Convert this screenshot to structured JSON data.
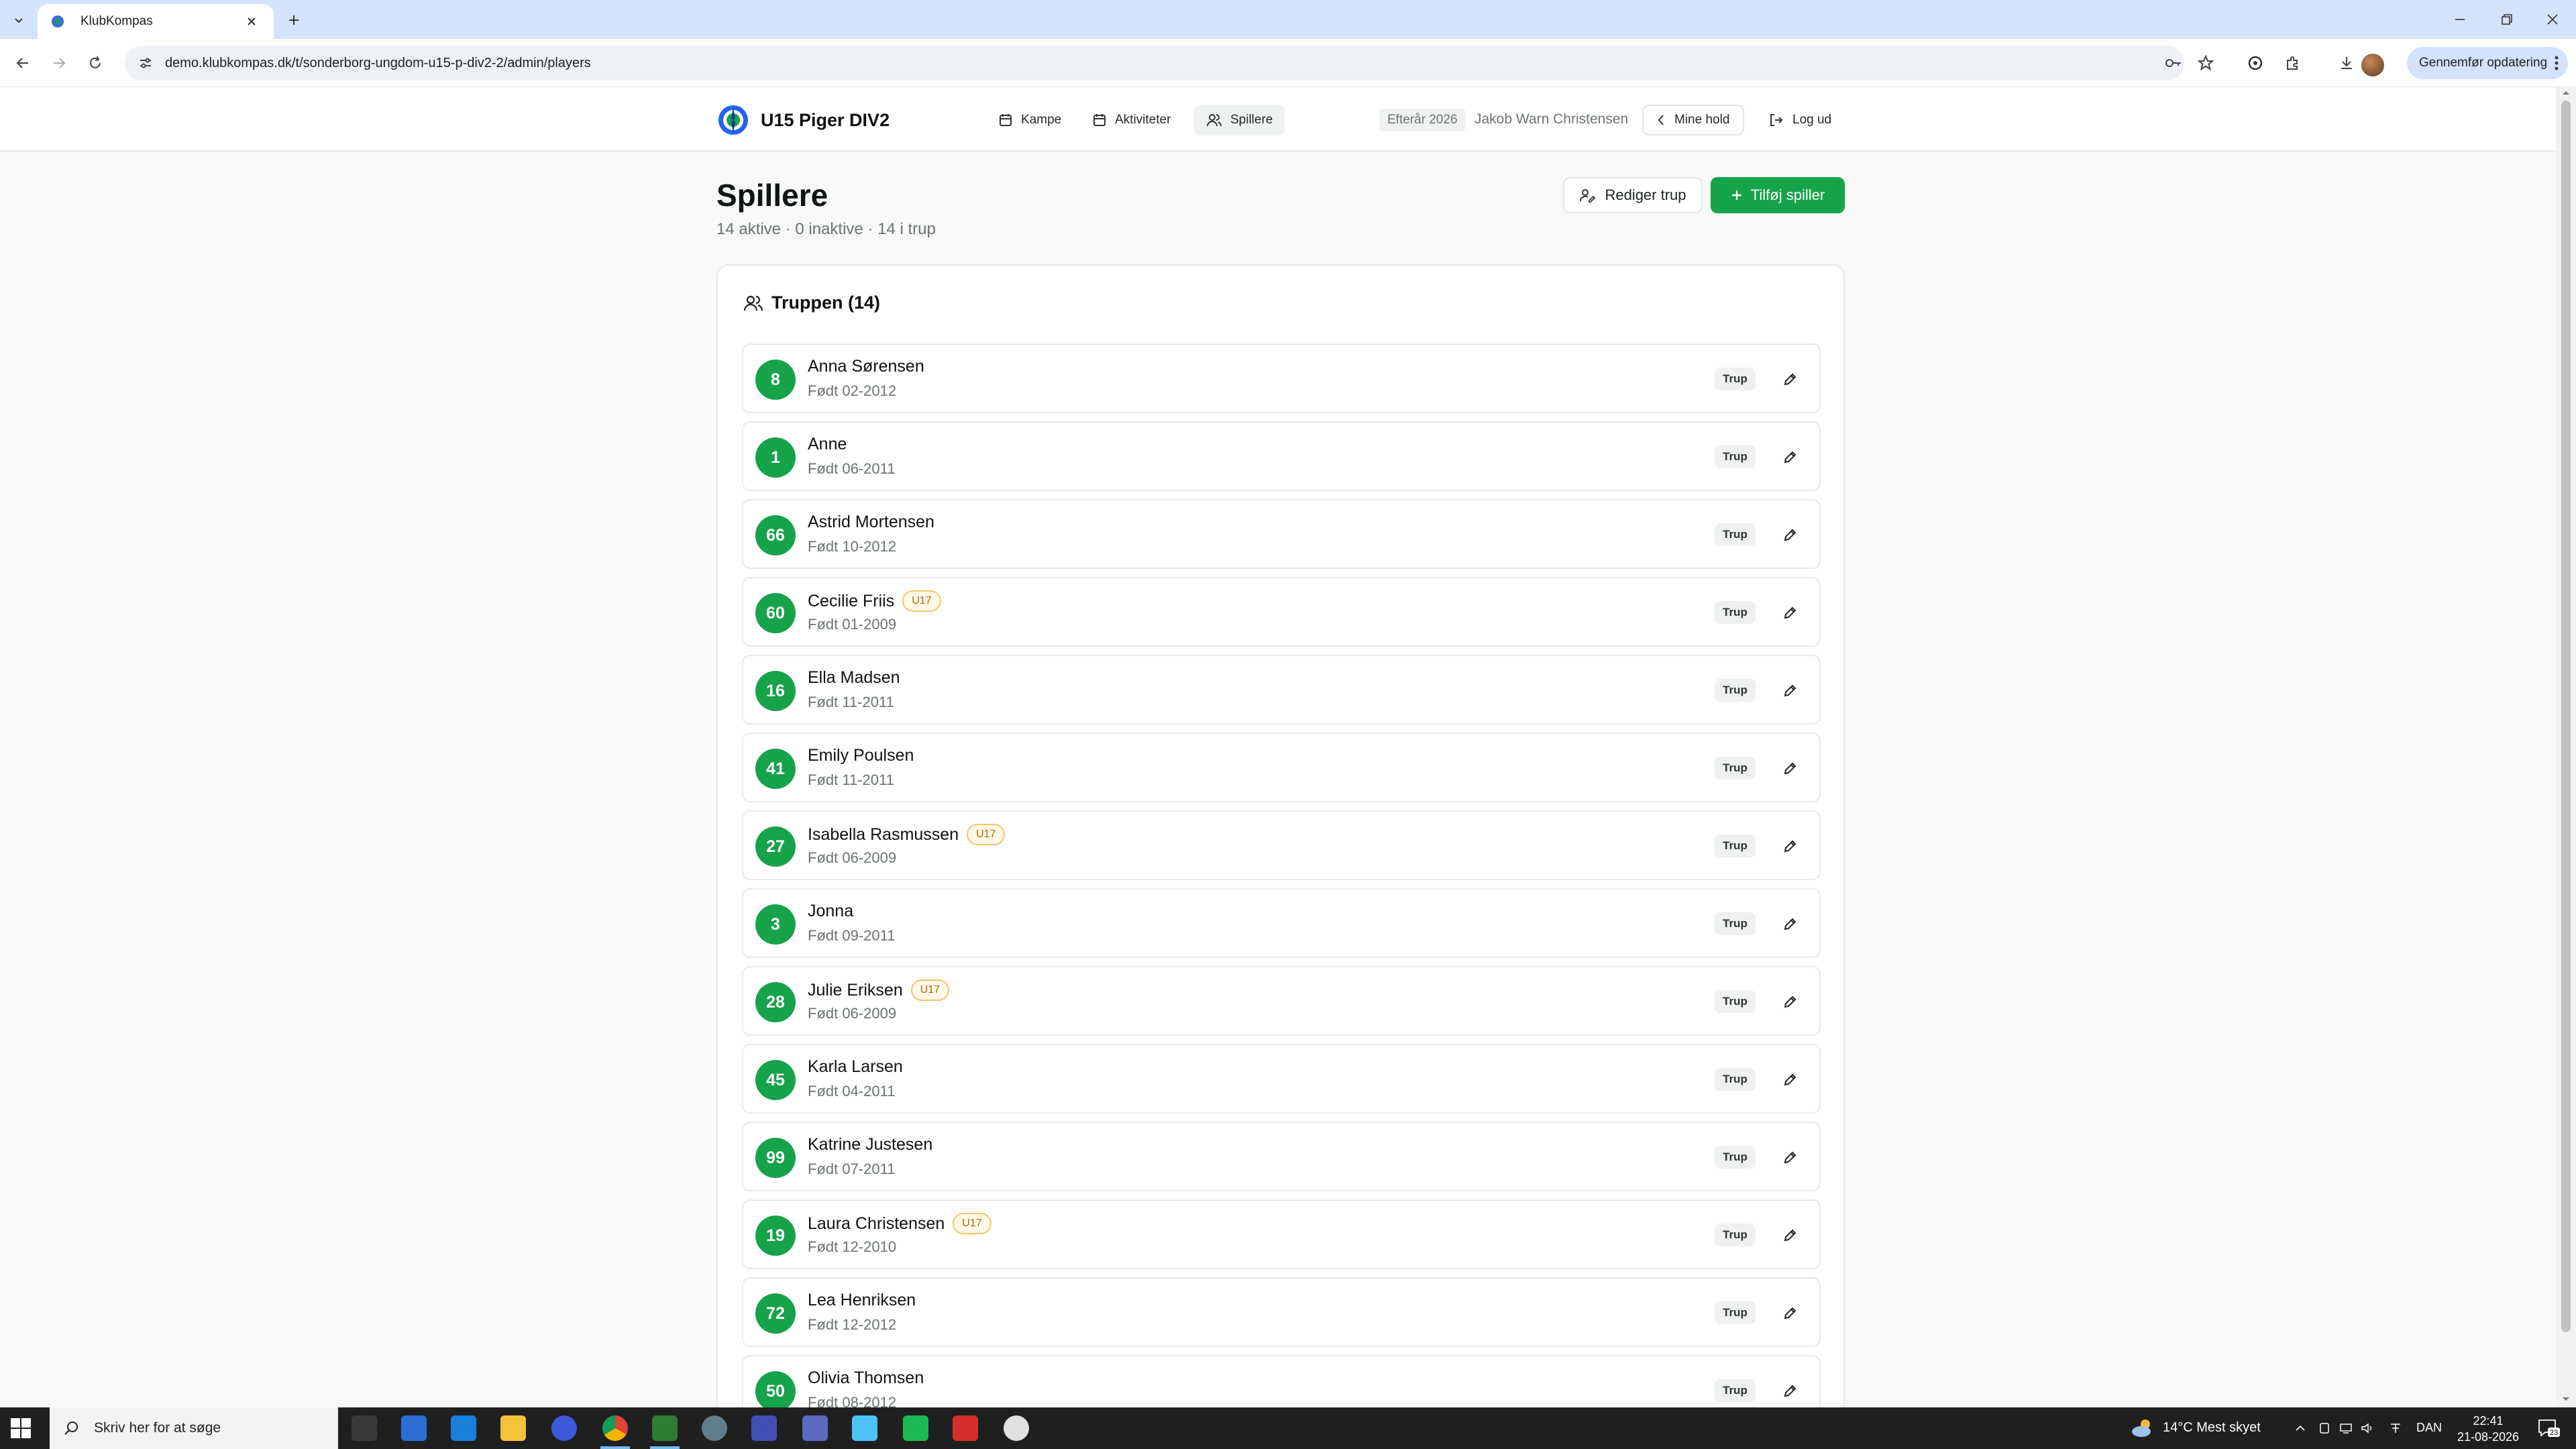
{
  "browser": {
    "tab_title": "KlubKompas",
    "url": "demo.klubkompas.dk/t/sonderborg-ungdom-u15-p-div2-2/admin/players",
    "update_label": "Gennemfør opdatering"
  },
  "header": {
    "team_name": "U15 Piger DIV2",
    "nav": [
      {
        "label": "Kampe",
        "icon": "calendar-icon"
      },
      {
        "label": "Aktiviteter",
        "icon": "calendar-icon"
      },
      {
        "label": "Spillere",
        "icon": "users-icon",
        "active": true
      }
    ],
    "season": "Efterår 2026",
    "user": "Jakob Warn Christensen",
    "mine_hold": "Mine hold",
    "logout": "Log ud"
  },
  "page": {
    "title": "Spillere",
    "subtitle": "14 aktive · 0 inaktive · 14 i trup",
    "edit_squad": "Rediger trup",
    "add_player": "Tilføj spiller"
  },
  "squad": {
    "heading": "Truppen (14)",
    "players": [
      {
        "number": "8",
        "name": "Anna Sørensen",
        "born": "Født 02-2012",
        "badge": "",
        "status": "Trup"
      },
      {
        "number": "1",
        "name": "Anne",
        "born": "Født 06-2011",
        "badge": "",
        "status": "Trup"
      },
      {
        "number": "66",
        "name": "Astrid Mortensen",
        "born": "Født 10-2012",
        "badge": "",
        "status": "Trup"
      },
      {
        "number": "60",
        "name": "Cecilie Friis",
        "born": "Født 01-2009",
        "badge": "U17",
        "status": "Trup"
      },
      {
        "number": "16",
        "name": "Ella Madsen",
        "born": "Født 11-2011",
        "badge": "",
        "status": "Trup"
      },
      {
        "number": "41",
        "name": "Emily Poulsen",
        "born": "Født 11-2011",
        "badge": "",
        "status": "Trup"
      },
      {
        "number": "27",
        "name": "Isabella Rasmussen",
        "born": "Født 06-2009",
        "badge": "U17",
        "status": "Trup"
      },
      {
        "number": "3",
        "name": "Jonna",
        "born": "Født 09-2011",
        "badge": "",
        "status": "Trup"
      },
      {
        "number": "28",
        "name": "Julie Eriksen",
        "born": "Født 06-2009",
        "badge": "U17",
        "status": "Trup"
      },
      {
        "number": "45",
        "name": "Karla Larsen",
        "born": "Født 04-2011",
        "badge": "",
        "status": "Trup"
      },
      {
        "number": "99",
        "name": "Katrine Justesen",
        "born": "Født 07-2011",
        "badge": "",
        "status": "Trup"
      },
      {
        "number": "19",
        "name": "Laura Christensen",
        "born": "Født 12-2010",
        "badge": "U17",
        "status": "Trup"
      },
      {
        "number": "72",
        "name": "Lea Henriksen",
        "born": "Født 12-2012",
        "badge": "",
        "status": "Trup"
      },
      {
        "number": "50",
        "name": "Olivia Thomsen",
        "born": "Født 08-2012",
        "badge": "",
        "status": "Trup"
      }
    ]
  },
  "taskbar": {
    "search_placeholder": "Skriv her for at søge",
    "weather": "14°C  Mest skyet",
    "language": "DAN",
    "time": "22:41",
    "date": "21-08-2026",
    "notifications": "23"
  },
  "colors": {
    "accent": "#16a34a",
    "badge_u17": "#f2c66d",
    "tab_strip": "#d3e3fd"
  }
}
